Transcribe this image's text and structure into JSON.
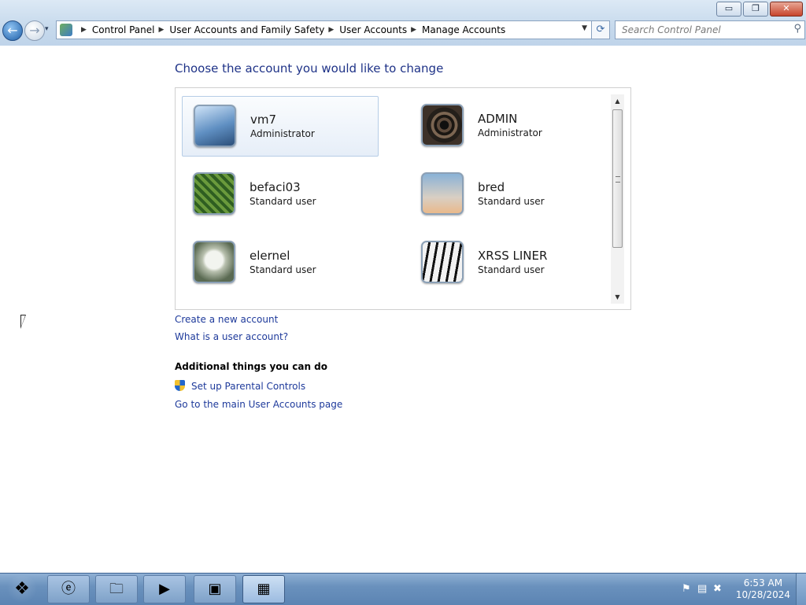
{
  "window": {
    "controls": {
      "minimize": "▭",
      "maximize": "❐",
      "close": "✕"
    }
  },
  "nav": {
    "back_glyph": "←",
    "forward_glyph": "→",
    "recent_glyph": "▾",
    "breadcrumbs": [
      {
        "label": "Control Panel"
      },
      {
        "label": "User Accounts and Family Safety"
      },
      {
        "label": "User Accounts"
      },
      {
        "label": "Manage Accounts"
      }
    ],
    "refresh_glyph": "⟳",
    "search_placeholder": "Search Control Panel"
  },
  "main": {
    "heading": "Choose the account you would like to change",
    "accounts": [
      {
        "name": "vm7",
        "role": "Administrator",
        "picture": "bridge",
        "selected": true
      },
      {
        "name": "ADMIN",
        "role": "Administrator",
        "picture": "spiral-staircase"
      },
      {
        "name": "befaci03",
        "role": "Standard user",
        "picture": "green-leaf"
      },
      {
        "name": "bred",
        "role": "Standard user",
        "picture": "lighthouse"
      },
      {
        "name": "elernel",
        "role": "Standard user",
        "picture": "white-flower"
      },
      {
        "name": "XRSS LINER",
        "role": "Standard user",
        "picture": "piano-keys"
      }
    ],
    "links": {
      "create_account": "Create a new account",
      "what_is": "What is a user account?"
    },
    "additional": {
      "heading": "Additional things you can do",
      "parental_controls": "Set up Parental Controls",
      "main_page": "Go to the main User Accounts page"
    }
  },
  "taskbar": {
    "pinned": [
      "windows-start-orb",
      "internet-explorer",
      "windows-explorer",
      "windows-media-player",
      "command-prompt",
      "control-panel"
    ],
    "active": "control-panel",
    "clock": {
      "time": "6:53 AM",
      "date": "10/28/2024"
    }
  }
}
